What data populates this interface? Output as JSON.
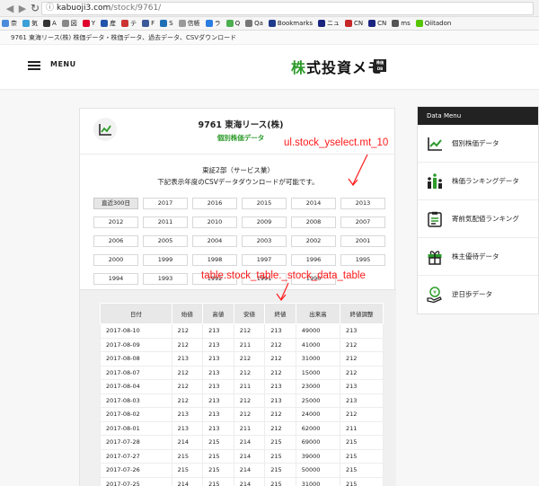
{
  "browser": {
    "url_host": "kabuoji3.com",
    "url_path": "/stock/9761/",
    "bookmarks": [
      {
        "label": "奈",
        "color": "#4a8bdc"
      },
      {
        "label": "気",
        "color": "#3aa0d8"
      },
      {
        "label": "A",
        "color": "#333333"
      },
      {
        "label": "図",
        "color": "#888888"
      },
      {
        "label": "Y",
        "color": "#e0002c"
      },
      {
        "label": "産",
        "color": "#2255aa"
      },
      {
        "label": "テ",
        "color": "#cc3333"
      },
      {
        "label": "F",
        "color": "#3b5998"
      },
      {
        "label": "S",
        "color": "#1f6fb5"
      },
      {
        "label": "信帳",
        "color": "#999999"
      },
      {
        "label": "ラ",
        "color": "#2a7de1"
      },
      {
        "label": "Q",
        "color": "#4caf50"
      },
      {
        "label": "Qa",
        "color": "#777777"
      },
      {
        "label": "Bookmarks",
        "color": "#1e3a8a"
      },
      {
        "label": "ニュ",
        "color": "#1a237e"
      },
      {
        "label": "CN",
        "color": "#c62828"
      },
      {
        "label": "CN",
        "color": "#1a237e"
      },
      {
        "label": "ms",
        "color": "#555555"
      },
      {
        "label": "Qiitadon",
        "color": "#55c500"
      }
    ]
  },
  "site": {
    "strip_text": "9761 東海リース(株) 株価データ・株価データ、過去データ、CSVダウンロード",
    "menu_label": "MENU",
    "logo_green": "株",
    "logo_rest": "式投資メモ",
    "logo_badge_line1": "株価",
    "logo_badge_line2": "DB"
  },
  "stock": {
    "title": "9761 東海リース(株)",
    "subtitle": "個別株価データ",
    "market": "東証2部（サービス業）",
    "note": "下記表示年度のCSVデータダウンロードが可能です。"
  },
  "years": [
    [
      "直近300日",
      "2017",
      "2016",
      "2015",
      "2014",
      "2013"
    ],
    [
      "2012",
      "2011",
      "2010",
      "2009",
      "2008",
      "2007"
    ],
    [
      "2006",
      "2005",
      "2004",
      "2003",
      "2002",
      "2001"
    ],
    [
      "2000",
      "1999",
      "1998",
      "1997",
      "1996",
      "1995"
    ],
    [
      "1994",
      "1993",
      "1992",
      "1991",
      "1990"
    ]
  ],
  "table": {
    "headers": [
      "日付",
      "始値",
      "高値",
      "安値",
      "終値",
      "出来高",
      "終値調整"
    ],
    "rows": [
      [
        "2017-08-10",
        "212",
        "213",
        "212",
        "213",
        "49000",
        "213"
      ],
      [
        "2017-08-09",
        "212",
        "213",
        "211",
        "212",
        "41000",
        "212"
      ],
      [
        "2017-08-08",
        "213",
        "213",
        "212",
        "212",
        "31000",
        "212"
      ],
      [
        "2017-08-07",
        "212",
        "213",
        "212",
        "212",
        "15000",
        "212"
      ],
      [
        "2017-08-04",
        "212",
        "213",
        "211",
        "213",
        "23000",
        "213"
      ],
      [
        "2017-08-03",
        "212",
        "213",
        "212",
        "213",
        "25000",
        "213"
      ],
      [
        "2017-08-02",
        "213",
        "213",
        "212",
        "212",
        "24000",
        "212"
      ],
      [
        "2017-08-01",
        "213",
        "213",
        "211",
        "212",
        "62000",
        "211"
      ],
      [
        "2017-07-28",
        "214",
        "215",
        "214",
        "215",
        "69000",
        "215"
      ],
      [
        "2017-07-27",
        "215",
        "215",
        "214",
        "215",
        "39000",
        "215"
      ],
      [
        "2017-07-26",
        "215",
        "215",
        "214",
        "215",
        "50000",
        "215"
      ],
      [
        "2017-07-25",
        "214",
        "215",
        "214",
        "215",
        "31000",
        "215"
      ]
    ]
  },
  "side": {
    "heading": "Data Menu",
    "items": [
      {
        "label": "個別株価データ",
        "icon": "chart-icon"
      },
      {
        "label": "株価ランキングデータ",
        "icon": "ranking-icon"
      },
      {
        "label": "寄前気配値ランキング",
        "icon": "clipboard-icon"
      },
      {
        "label": "株主優待データ",
        "icon": "gift-icon"
      },
      {
        "label": "逆日歩データ",
        "icon": "yen-hand-icon"
      }
    ]
  },
  "annotations": {
    "yselect": "ul.stock_yselect.mt_10",
    "table": "table.stock_table._stock_data_table",
    "color": "#ff1a1a"
  }
}
